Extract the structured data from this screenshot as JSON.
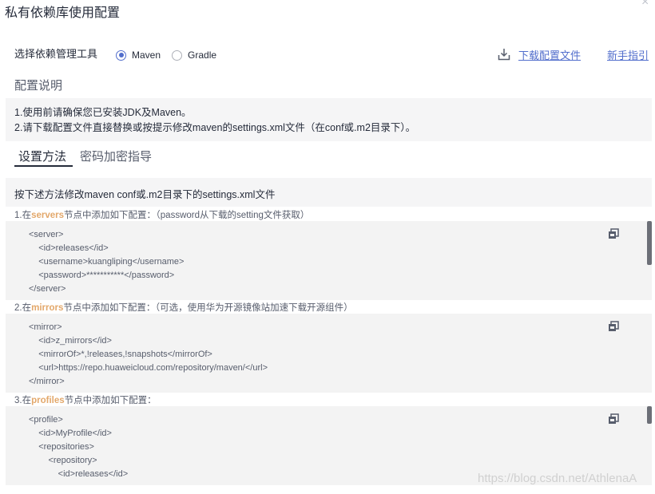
{
  "dialog": {
    "title": "私有依赖库使用配置",
    "close_icon": "×"
  },
  "tool": {
    "label": "选择依赖管理工具",
    "options": [
      {
        "label": "Maven",
        "checked": true
      },
      {
        "label": "Gradle",
        "checked": false
      }
    ]
  },
  "links": {
    "download": "下载配置文件",
    "guide": "新手指引"
  },
  "config": {
    "title": "配置说明",
    "lines": [
      "1.使用前请确保您已安装JDK及Maven。",
      "2.请下载配置文件直接替换或按提示修改maven的settings.xml文件（在conf或.m2目录下）。"
    ]
  },
  "tabs": [
    {
      "label": "设置方法"
    },
    {
      "label": "密码加密指导"
    }
  ],
  "method": {
    "text": "按下述方法修改maven conf或.m2目录下的settings.xml文件"
  },
  "steps": [
    {
      "prefix": "1.在",
      "keyword": "servers",
      "suffix": "节点中添加如下配置：（password从下载的setting文件获取）",
      "code": [
        "<server>",
        "    <id>releases</id>",
        "    <username>kuangliping</username>",
        "    <password>***********</password>",
        "</server>"
      ]
    },
    {
      "prefix": "2.在",
      "keyword": "mirrors",
      "suffix": "节点中添加如下配置：（可选，使用华为开源镜像站加速下载开源组件）",
      "code": [
        "<mirror>",
        "    <id>z_mirrors</id>",
        "    <mirrorOf>*,!releases,!snapshots</mirrorOf>",
        "    <url>https://repo.huaweicloud.com/repository/maven/</url>",
        "</mirror>"
      ]
    },
    {
      "prefix": "3.在",
      "keyword": "profiles",
      "suffix": "节点中添加如下配置：",
      "code": [
        "<profile>",
        "    <id>MyProfile</id>",
        "    <repositories>",
        "        <repository>",
        "            <id>releases</id>"
      ]
    }
  ],
  "watermark": "https://blog.csdn.net/AthlenaA",
  "colors": {
    "accent": "#526ecc",
    "keyword": "#e3a86b",
    "code_bg": "#f3f3f3",
    "panel_bg": "#f5f5f6"
  }
}
